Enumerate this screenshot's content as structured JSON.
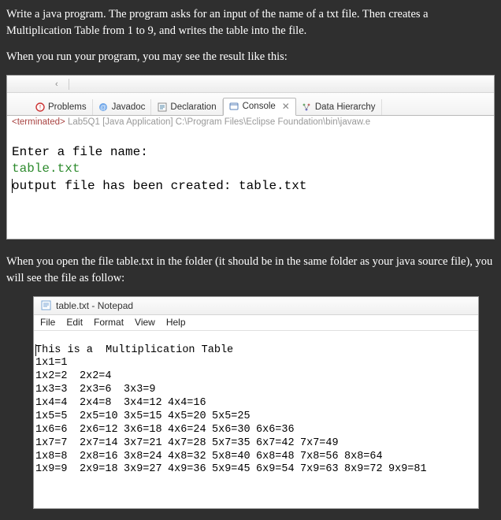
{
  "instructions": {
    "p1": "Write a java program. The program asks for an input of the name of a txt file. Then  creates a Multiplication Table from 1 to 9, and writes the table into the file.",
    "p2": "When you run your program, you may see the result like this:",
    "p3": "When you open the file table.txt in the folder (it should  be in the same folder as your java source file), you will see the file as follow:"
  },
  "eclipse": {
    "tabs": {
      "problems": "Problems",
      "javadoc": "Javadoc",
      "declaration": "Declaration",
      "console": "Console",
      "data_hierarchy": "Data Hierarchy"
    },
    "status": {
      "terminated": "<terminated>",
      "rest": " Lab5Q1 [Java Application] C:\\Program Files\\Eclipse Foundation\\bin\\javaw.e"
    },
    "console_lines": {
      "l1": "Enter a file name:",
      "l2": "table.txt",
      "l3": "output file has been created: table.txt"
    }
  },
  "notepad": {
    "title": "table.txt - Notepad",
    "menu": {
      "file": "File",
      "edit": "Edit",
      "format": "Format",
      "view": "View",
      "help": "Help"
    },
    "header_line": "This is a  Multiplication Table"
  },
  "chart_data": {
    "type": "table",
    "title": "Multiplication Table 1 to 9",
    "rows": [
      [
        "1x1=1"
      ],
      [
        "1x2=2",
        "2x2=4"
      ],
      [
        "1x3=3",
        "2x3=6",
        "3x3=9"
      ],
      [
        "1x4=4",
        "2x4=8",
        "3x4=12",
        "4x4=16"
      ],
      [
        "1x5=5",
        "2x5=10",
        "3x5=15",
        "4x5=20",
        "5x5=25"
      ],
      [
        "1x6=6",
        "2x6=12",
        "3x6=18",
        "4x6=24",
        "5x6=30",
        "6x6=36"
      ],
      [
        "1x7=7",
        "2x7=14",
        "3x7=21",
        "4x7=28",
        "5x7=35",
        "6x7=42",
        "7x7=49"
      ],
      [
        "1x8=8",
        "2x8=16",
        "3x8=24",
        "4x8=32",
        "5x8=40",
        "6x8=48",
        "7x8=56",
        "8x8=64"
      ],
      [
        "1x9=9",
        "2x9=18",
        "3x9=27",
        "4x9=36",
        "5x9=45",
        "6x9=54",
        "7x9=63",
        "8x9=72",
        "9x9=81"
      ]
    ]
  }
}
